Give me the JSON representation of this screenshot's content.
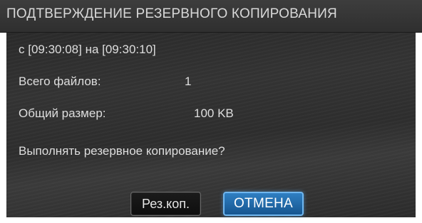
{
  "dialog": {
    "title": "ПОДТВЕРЖДЕНИЕ РЕЗЕРВНОГО КОПИРОВАНИЯ",
    "time_range": "с [09:30:08] на [09:30:10]",
    "files_label": "Всего файлов:",
    "files_value": "1",
    "size_label": "Общий размер:",
    "size_value": "100 KB",
    "question": "Выполнять резервное копирование?",
    "buttons": {
      "backup": "Рез.коп.",
      "cancel": "ОТМЕНА"
    }
  },
  "colors": {
    "title_bar": "#363636",
    "body_bg": "#2f2f2f",
    "text": "#dedede",
    "cancel_accent": "#2f7fc2"
  }
}
